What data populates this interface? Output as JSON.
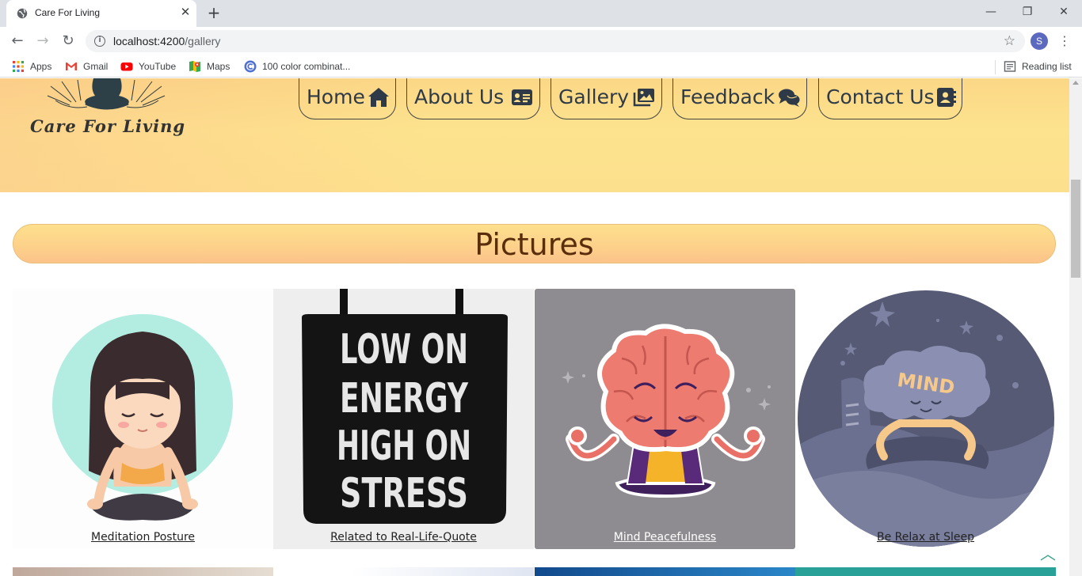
{
  "browser": {
    "tab_title": "Care For Living",
    "url_host": "localhost:4200",
    "url_path": "/gallery",
    "profile_initial": "S",
    "bookmarks": [
      "Apps",
      "Gmail",
      "YouTube",
      "Maps",
      "100 color combinat..."
    ],
    "reading_list": "Reading list"
  },
  "site": {
    "logo_text": "Care For Living",
    "nav": [
      {
        "label": "Home",
        "icon": "home-icon"
      },
      {
        "label": "About Us",
        "icon": "id-card-icon"
      },
      {
        "label": "Gallery",
        "icon": "images-icon"
      },
      {
        "label": "Feedback",
        "icon": "comments-icon"
      },
      {
        "label": "Contact Us",
        "icon": "address-book-icon"
      }
    ]
  },
  "gallery": {
    "heading": "Pictures",
    "items": [
      {
        "caption": "Meditation Posture",
        "image": "meditating-girl-illustration"
      },
      {
        "caption": "Related to Real-Life-Quote",
        "image": "tote-bag-quote",
        "quote_lines": [
          "LOW ON",
          "ENERGY",
          "HIGH ON",
          "STRESS"
        ]
      },
      {
        "caption": "Mind Peacefulness",
        "image": "meditating-brain-illustration"
      },
      {
        "caption": "Be Relax at Sleep",
        "image": "sleeping-mind-illustration",
        "badge_text": "MIND"
      }
    ]
  },
  "colors": {
    "header_yellow": "#fde08d",
    "heading_brown": "#5a2d0c",
    "nav_text": "#2e3a47",
    "back_to_top": "#3aa28a"
  }
}
